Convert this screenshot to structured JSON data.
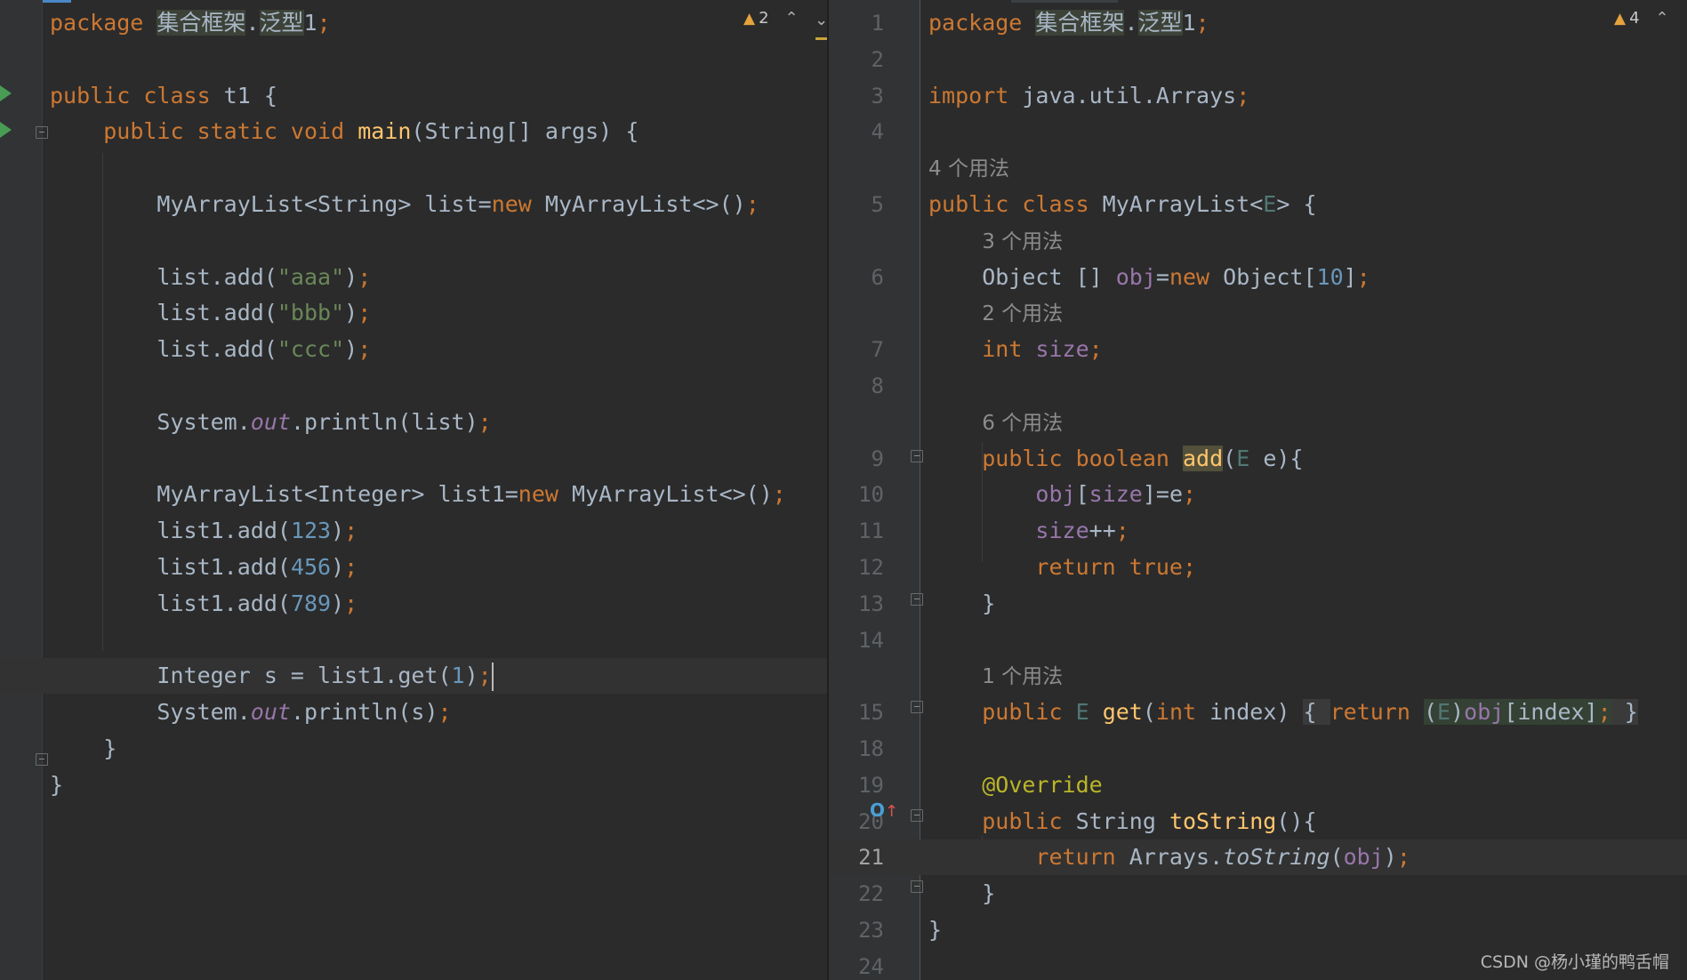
{
  "left_editor": {
    "file": "t1",
    "warnings": "2",
    "lines": [
      {
        "tokens": [
          [
            "kw",
            "package "
          ],
          [
            "pkghl",
            "集合框架"
          ],
          [
            "",
            "."
          ],
          [
            "pkghl",
            "泛型"
          ],
          [
            "",
            "1"
          ],
          [
            "kw",
            ";"
          ]
        ]
      },
      {
        "tokens": []
      },
      {
        "tokens": [
          [
            "kw",
            "public class "
          ],
          [
            "",
            "t1 {"
          ]
        ]
      },
      {
        "tokens": [
          [
            "",
            "    "
          ],
          [
            "kw",
            "public static void "
          ],
          [
            "fn",
            "main"
          ],
          [
            "",
            "(String[] args) {"
          ]
        ]
      },
      {
        "tokens": []
      },
      {
        "tokens": [
          [
            "",
            "        MyArrayList<String> list="
          ],
          [
            "kw",
            "new "
          ],
          [
            "",
            "MyArrayList<>()"
          ],
          [
            "kw",
            ";"
          ]
        ]
      },
      {
        "tokens": []
      },
      {
        "tokens": [
          [
            "",
            "        list.add("
          ],
          [
            "str",
            "\"aaa\""
          ],
          [
            "",
            ")"
          ],
          [
            "kw",
            ";"
          ]
        ]
      },
      {
        "tokens": [
          [
            "",
            "        list.add("
          ],
          [
            "str",
            "\"bbb\""
          ],
          [
            "",
            ")"
          ],
          [
            "kw",
            ";"
          ]
        ]
      },
      {
        "tokens": [
          [
            "",
            "        list.add("
          ],
          [
            "str",
            "\"ccc\""
          ],
          [
            "",
            ")"
          ],
          [
            "kw",
            ";"
          ]
        ]
      },
      {
        "tokens": []
      },
      {
        "tokens": [
          [
            "",
            "        System."
          ],
          [
            "sfield",
            "out"
          ],
          [
            "",
            ".println(list)"
          ],
          [
            "kw",
            ";"
          ]
        ]
      },
      {
        "tokens": []
      },
      {
        "tokens": [
          [
            "",
            "        MyArrayList<Integer> list1="
          ],
          [
            "kw",
            "new "
          ],
          [
            "",
            "MyArrayList<>()"
          ],
          [
            "kw",
            ";"
          ]
        ]
      },
      {
        "tokens": [
          [
            "",
            "        list1.add("
          ],
          [
            "num",
            "123"
          ],
          [
            "",
            ")"
          ],
          [
            "kw",
            ";"
          ]
        ]
      },
      {
        "tokens": [
          [
            "",
            "        list1.add("
          ],
          [
            "num",
            "456"
          ],
          [
            "",
            ")"
          ],
          [
            "kw",
            ";"
          ]
        ]
      },
      {
        "tokens": [
          [
            "",
            "        list1.add("
          ],
          [
            "num",
            "789"
          ],
          [
            "",
            ")"
          ],
          [
            "kw",
            ";"
          ]
        ]
      },
      {
        "tokens": []
      },
      {
        "tokens": [
          [
            "",
            "        Integer s = list1.get("
          ],
          [
            "num",
            "1"
          ],
          [
            "",
            ")"
          ],
          [
            "kw",
            ";"
          ],
          [
            "caret",
            ""
          ]
        ],
        "current": true
      },
      {
        "tokens": [
          [
            "",
            "        System."
          ],
          [
            "sfield",
            "out"
          ],
          [
            "",
            ".println(s)"
          ],
          [
            "kw",
            ";"
          ]
        ]
      },
      {
        "tokens": [
          [
            "",
            "    }"
          ]
        ]
      },
      {
        "tokens": [
          [
            "",
            "}"
          ]
        ]
      }
    ]
  },
  "right_editor": {
    "file": "MyArrayList",
    "warnings": "4",
    "lines": [
      {
        "num": "1",
        "tokens": [
          [
            "kw",
            "package "
          ],
          [
            "pkghl",
            "集合框架"
          ],
          [
            "",
            "."
          ],
          [
            "pkghl",
            "泛型"
          ],
          [
            "",
            "1"
          ],
          [
            "kw",
            ";"
          ]
        ]
      },
      {
        "num": "2",
        "tokens": []
      },
      {
        "num": "3",
        "tokens": [
          [
            "kw",
            "import "
          ],
          [
            "",
            "java.util.Arrays"
          ],
          [
            "kw",
            ";"
          ]
        ]
      },
      {
        "num": "4",
        "tokens": []
      },
      {
        "num": "",
        "tokens": [
          [
            "hint",
            "4 个用法"
          ]
        ]
      },
      {
        "num": "5",
        "tokens": [
          [
            "kw",
            "public class "
          ],
          [
            "",
            "MyArrayList<"
          ],
          [
            "tp",
            "E"
          ],
          [
            "",
            "> {"
          ]
        ]
      },
      {
        "num": "",
        "tokens": [
          [
            "",
            "    "
          ],
          [
            "hint",
            "3 个用法"
          ]
        ]
      },
      {
        "num": "6",
        "tokens": [
          [
            "",
            "    Object [] "
          ],
          [
            "field",
            "obj"
          ],
          [
            "",
            "="
          ],
          [
            "kw",
            "new "
          ],
          [
            "",
            "Object["
          ],
          [
            "num",
            "10"
          ],
          [
            "",
            "]"
          ],
          [
            "kw",
            ";"
          ]
        ]
      },
      {
        "num": "",
        "tokens": [
          [
            "",
            "    "
          ],
          [
            "hint",
            "2 个用法"
          ]
        ]
      },
      {
        "num": "7",
        "tokens": [
          [
            "",
            "    "
          ],
          [
            "kw",
            "int "
          ],
          [
            "field",
            "size"
          ],
          [
            "kw",
            ";"
          ]
        ]
      },
      {
        "num": "8",
        "tokens": []
      },
      {
        "num": "",
        "tokens": [
          [
            "",
            "    "
          ],
          [
            "hint",
            "6 个用法"
          ]
        ]
      },
      {
        "num": "9",
        "tokens": [
          [
            "",
            "    "
          ],
          [
            "kw",
            "public boolean "
          ],
          [
            "addhl",
            "add"
          ],
          [
            "",
            "("
          ],
          [
            "tp",
            "E"
          ],
          [
            "",
            " e){"
          ]
        ]
      },
      {
        "num": "10",
        "tokens": [
          [
            "",
            "        "
          ],
          [
            "field",
            "obj"
          ],
          [
            "",
            "["
          ],
          [
            "field",
            "size"
          ],
          [
            "",
            "]=e"
          ],
          [
            "kw",
            ";"
          ]
        ]
      },
      {
        "num": "11",
        "tokens": [
          [
            "",
            "        "
          ],
          [
            "field",
            "size"
          ],
          [
            "",
            "++"
          ],
          [
            "kw",
            ";"
          ]
        ]
      },
      {
        "num": "12",
        "tokens": [
          [
            "",
            "        "
          ],
          [
            "kw",
            "return true;"
          ]
        ]
      },
      {
        "num": "13",
        "tokens": [
          [
            "",
            "    }"
          ]
        ]
      },
      {
        "num": "14",
        "tokens": []
      },
      {
        "num": "",
        "tokens": [
          [
            "",
            "    "
          ],
          [
            "hint",
            "1 个用法"
          ]
        ]
      },
      {
        "num": "15",
        "tokens": [
          [
            "",
            "    "
          ],
          [
            "kw",
            "public "
          ],
          [
            "tp",
            "E "
          ],
          [
            "fn",
            "get"
          ],
          [
            "",
            "("
          ],
          [
            "kw",
            "int "
          ],
          [
            "",
            "index) "
          ],
          [
            "fold-bg",
            "{ "
          ],
          [
            "kw",
            "return "
          ],
          [
            "castbg",
            "("
          ],
          [
            "castbg-tp",
            "E"
          ],
          [
            "castbg",
            ")"
          ],
          [
            "castbg-field",
            "obj"
          ],
          [
            "castbg",
            "[index]"
          ],
          [
            "castbg-kw",
            ";"
          ],
          [
            "fold-bg",
            " }"
          ]
        ]
      },
      {
        "num": "18",
        "tokens": []
      },
      {
        "num": "19",
        "tokens": [
          [
            "",
            "    "
          ],
          [
            "ann",
            "@Override"
          ]
        ]
      },
      {
        "num": "20",
        "tokens": [
          [
            "",
            "    "
          ],
          [
            "kw",
            "public "
          ],
          [
            "",
            "String "
          ],
          [
            "fn",
            "toString"
          ],
          [
            "",
            "(){"
          ]
        ]
      },
      {
        "num": "21",
        "tokens": [
          [
            "",
            "        "
          ],
          [
            "kw",
            "return "
          ],
          [
            "",
            "Arrays."
          ],
          [
            "italic",
            "toString"
          ],
          [
            "",
            "("
          ],
          [
            "field",
            "obj"
          ],
          [
            "",
            ")"
          ],
          [
            "kw",
            ";"
          ]
        ],
        "current": true
      },
      {
        "num": "22",
        "tokens": [
          [
            "",
            "    }"
          ]
        ]
      },
      {
        "num": "23",
        "tokens": [
          [
            "",
            "}"
          ]
        ]
      },
      {
        "num": "24",
        "tokens": []
      }
    ]
  },
  "watermark": "CSDN @杨小瑾的鸭舌帽",
  "colors": {
    "background": "#2b2b2b",
    "keyword": "#cc7832",
    "string": "#6a8759",
    "number": "#6897bb",
    "field": "#9876aa",
    "function": "#ffc66d",
    "annotation": "#bbb529"
  }
}
